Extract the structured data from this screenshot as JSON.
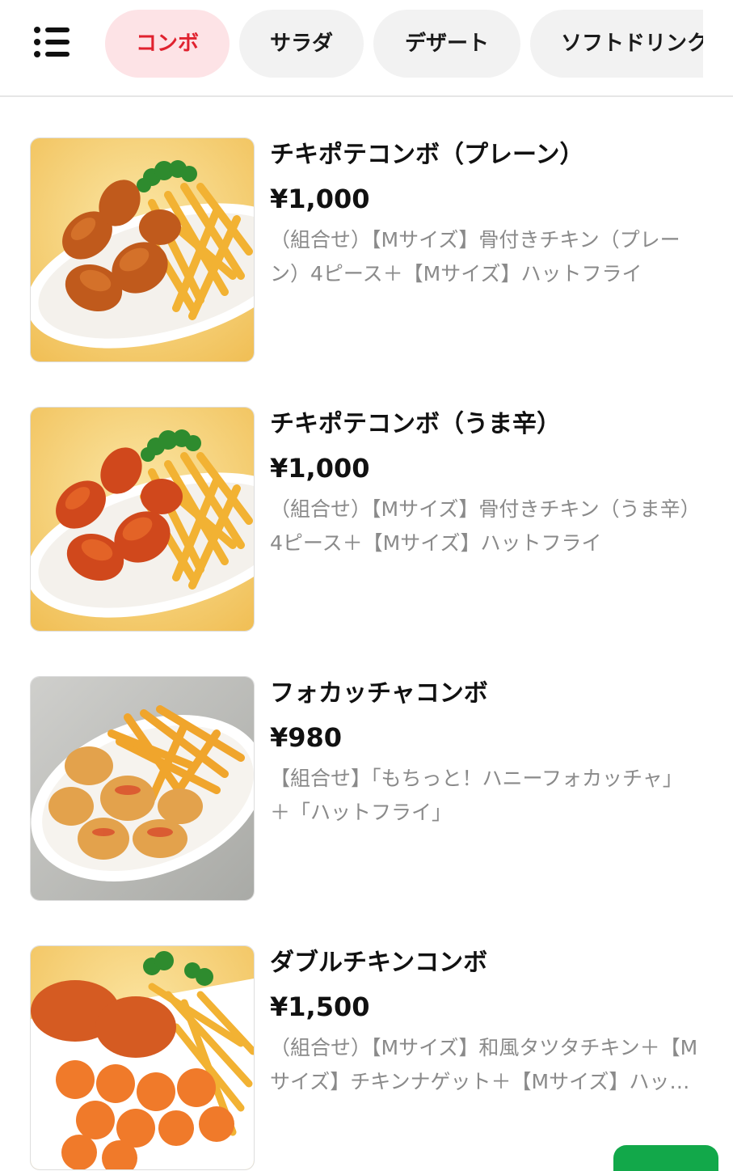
{
  "header": {
    "menu_icon": "list-menu-icon",
    "tabs": [
      {
        "label": "コンボ",
        "active": true
      },
      {
        "label": "サラダ",
        "active": false
      },
      {
        "label": "デザート",
        "active": false
      },
      {
        "label": "ソフトドリンク",
        "active": false
      }
    ]
  },
  "colors": {
    "active_tab_bg": "#fde3e6",
    "active_tab_text": "#e0222f",
    "tab_bg": "#f2f2f2",
    "desc_text": "#8a8a8a",
    "cart_button": "#12a84a"
  },
  "items": [
    {
      "name": "チキポテコンボ（プレーン）",
      "price": "¥1,000",
      "description": "（組合せ）【Mサイズ】骨付きチキン（プレーン）4ピース＋【Mサイズ】ハットフライ",
      "image": "fried-chicken-plain-and-fries-photo"
    },
    {
      "name": "チキポテコンボ（うま辛）",
      "price": "¥1,000",
      "description": "（組合せ）【Mサイズ】骨付きチキン（うま辛）4ピース＋【Mサイズ】ハットフライ",
      "image": "spicy-fried-chicken-and-fries-photo"
    },
    {
      "name": "フォカッチャコンボ",
      "price": "¥980",
      "description": "【組合せ】「もちっと！ハニーフォカッチャ」＋「ハットフライ」",
      "image": "focaccia-and-fries-photo"
    },
    {
      "name": "ダブルチキンコンボ",
      "price": "¥1,500",
      "description": "（組合せ）【Mサイズ】和風タツタチキン＋【Mサイズ】チキンナゲット＋【Mサイズ】ハットフライ",
      "image": "tatsuta-chicken-nuggets-and-fries-photo"
    }
  ]
}
